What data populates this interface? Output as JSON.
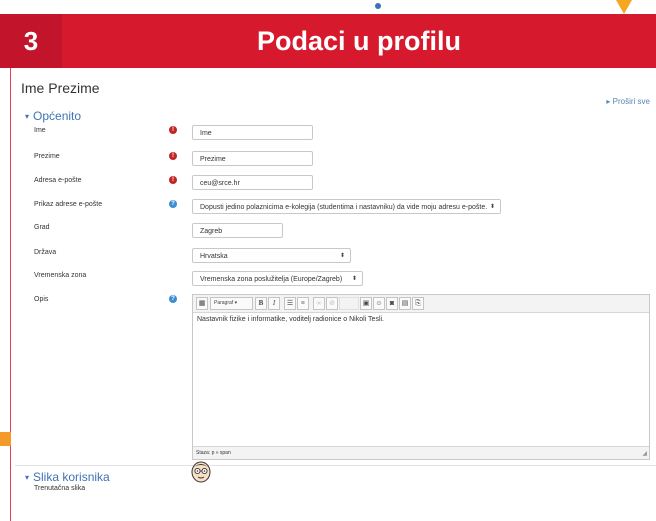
{
  "banner": {
    "number": "3",
    "title": "Podaci u profilu"
  },
  "page": {
    "heading": "Ime Prezime",
    "expand_all": "Proširi sve"
  },
  "sections": {
    "general": "Općenito",
    "user_picture": "Slika korisnika"
  },
  "form": {
    "first_name": {
      "label": "Ime",
      "value": "Ime"
    },
    "last_name": {
      "label": "Prezime",
      "value": "Prezime"
    },
    "email": {
      "label": "Adresa e-pošte",
      "value": "ceu@srce.hr"
    },
    "email_display": {
      "label": "Prikaz adrese e-pošte",
      "value": "Dopusti jedino polaznicima e-kolegija (studentima i nastavniku) da vide moju adresu e-pošte."
    },
    "city": {
      "label": "Grad",
      "value": "Zagreb"
    },
    "country": {
      "label": "Država",
      "value": "Hrvatska"
    },
    "timezone": {
      "label": "Vremenska zona",
      "value": "Vremenska zona poslužitelja (Europe/Zagreb)"
    },
    "description": {
      "label": "Opis",
      "paragraph_select": "Paragraf",
      "text": "Nastavnik fizike i informatike, voditelj radionice o Nikoli Tesli.",
      "path": "Staza: p » span"
    },
    "current_picture_label": "Trenutačna slika"
  },
  "icons": {
    "required": "exclamation-icon",
    "help": "question-icon",
    "dropdown": "dropdown-arrow-icon",
    "section_toggle": "triangle-down-icon"
  },
  "colors": {
    "banner": "#d7192d",
    "link": "#3f73b5",
    "required": "#c02626",
    "help": "#3d8ed1"
  }
}
